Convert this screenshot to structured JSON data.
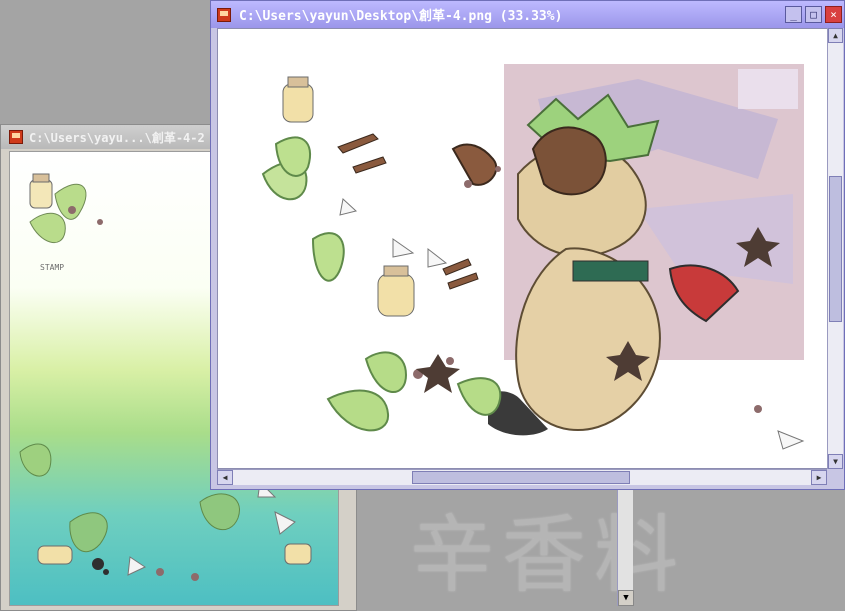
{
  "desktop": {
    "background_color": "#a4a4a4",
    "watermark_text": "辛香料"
  },
  "back_window": {
    "title": "C:\\Users\\yayu...\\創革-4-2",
    "accent_color": "#bdbdbd",
    "image_caption": "STAMP"
  },
  "front_window": {
    "title": "C:\\Users\\yayun\\Desktop\\創革-4.png (33.33%)",
    "accent_color": "#9b96ea",
    "buttons": {
      "minimize": "minimize",
      "maximize": "maximize",
      "close": "close"
    },
    "scrollbars": {
      "vertical": "visible",
      "horizontal": "visible"
    }
  }
}
